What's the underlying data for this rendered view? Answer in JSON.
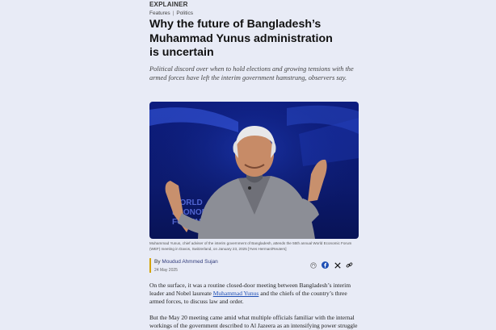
{
  "article": {
    "kicker": "EXPLAINER",
    "breadcrumbs": [
      "Features",
      "Politics"
    ],
    "title": "Why the future of Bangladesh’s Muhammad Yunus administration is uncertain",
    "dek": "Political discord over when to hold elections and growing tensions with the armed forces have left the interim government hamstrung, observers say.",
    "image_text": "WORLD ECONOMIC FORUM",
    "caption": "Muhammad Yunus, chief adviser of the interim government of Bangladesh, attends the 55th annual World Economic Forum (WEF) meeting in Davos, Switzerland, on January 23, 2025 [Yves Herman/Reuters]",
    "byline_prefix": "By",
    "author": "Moudud Ahmmed Sujan",
    "date": "24 May 2025",
    "para1_a": "On the surface, it was a routine closed-door meeting between Bangladesh’s interim leader and Nobel laureate ",
    "para1_link": "Muhammad Yunus",
    "para1_b": " and the chiefs of the country’s three armed forces, to discuss law and order.",
    "para2": "But the May 20 meeting came amid what multiple officials familiar with the internal workings of the government described to Al Jazeera as an intensifying power struggle"
  },
  "share_icons": [
    "headphones-icon",
    "facebook-icon",
    "x-icon",
    "link-icon"
  ],
  "colors": {
    "background": "#e8ebf6",
    "accent": "#d4a300",
    "link": "#1e4fb5",
    "hero_bg": "#0d1d80"
  }
}
